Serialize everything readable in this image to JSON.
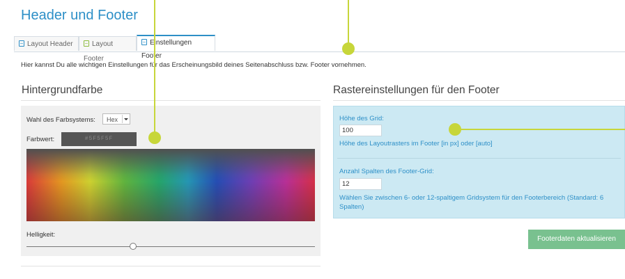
{
  "page": {
    "title": "Header und Footer"
  },
  "tabs": [
    {
      "label": "Layout Header",
      "icon": "document-icon"
    },
    {
      "label": "Layout Footer",
      "icon": "document-icon"
    },
    {
      "label": "Einstellungen Footer",
      "icon": "document-icon",
      "active": true
    }
  ],
  "intro": "Hier kannst Du alle wichtigen Einstellungen für das Erscheinungsbild deines Seitenabschluss bzw. Footer vornehmen.",
  "background": {
    "title": "Hintergrundfarbe",
    "color_system_label": "Wahl des Farbsystems:",
    "color_system_value": "Hex",
    "color_value_label": "Farbwert:",
    "color_value": "#5F5F5F",
    "brightness_label": "Helligkeit:",
    "brightness_level": 0.37
  },
  "grid": {
    "title": "Rastereinstellungen für den Footer",
    "height_label": "Höhe des Grid:",
    "height_value": "100",
    "height_help": "Höhe des Layoutrasters im Footer [in px] oder [auto]",
    "columns_label": "Anzahl Spalten des Footer-Grid:",
    "columns_value": "12",
    "columns_help": "Wählen Sie zwischen 6- oder 12-spaltigem Gridsystem für den Footerbereich (Standard: 6 Spalten)"
  },
  "actions": {
    "update_label": "Footerdaten aktualisieren"
  },
  "colors": {
    "accent": "#2d8fc7",
    "callout": "#c7d63a",
    "button": "#79c18f",
    "panel_blue": "#cce9f3"
  }
}
